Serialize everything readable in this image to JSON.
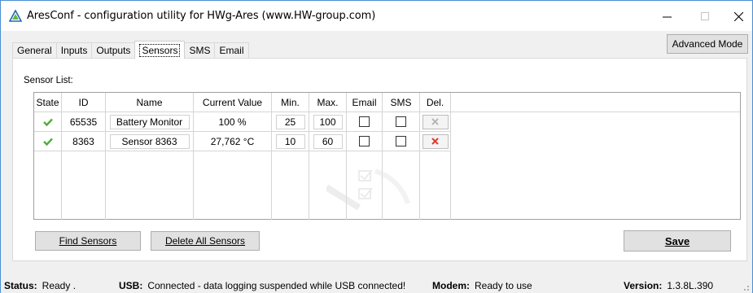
{
  "window": {
    "title": "AresConf - configuration utility for HWg-Ares (www.HW-group.com)",
    "advanced_mode_label": "Advanced Mode"
  },
  "tabs": [
    {
      "label": "General"
    },
    {
      "label": "Inputs"
    },
    {
      "label": "Outputs"
    },
    {
      "label": "Sensors",
      "active": true
    },
    {
      "label": "SMS"
    },
    {
      "label": "Email"
    }
  ],
  "sensors": {
    "list_label": "Sensor List:",
    "columns": [
      "State",
      "ID",
      "Name",
      "Current Value",
      "Min.",
      "Max.",
      "Email",
      "SMS",
      "Del."
    ],
    "rows": [
      {
        "state": "ok-icon",
        "id": "65535",
        "name": "Battery Monitor",
        "value": "100 %",
        "min": "25",
        "max": "100",
        "email": false,
        "sms": false,
        "delete_enabled": false
      },
      {
        "state": "ok-icon",
        "id": "8363",
        "name": "Sensor 8363",
        "value": "27,762 °C",
        "min": "10",
        "max": "60",
        "email": false,
        "sms": false,
        "delete_enabled": true
      }
    ],
    "find_label": "Find Sensors",
    "delete_all_label": "Delete All Sensors",
    "save_label": "Save"
  },
  "status": {
    "status_label": "Status:",
    "status_value": "Ready .",
    "usb_label": "USB:",
    "usb_value": "Connected - data logging suspended while USB connected!",
    "modem_label": "Modem:",
    "modem_value": "Ready to use",
    "version_label": "Version:",
    "version_value": "1.3.8L.390"
  },
  "colors": {
    "accent_border": "#4a8fd4",
    "ok_green": "#4caf3a",
    "delete_red": "#e03c2c"
  }
}
